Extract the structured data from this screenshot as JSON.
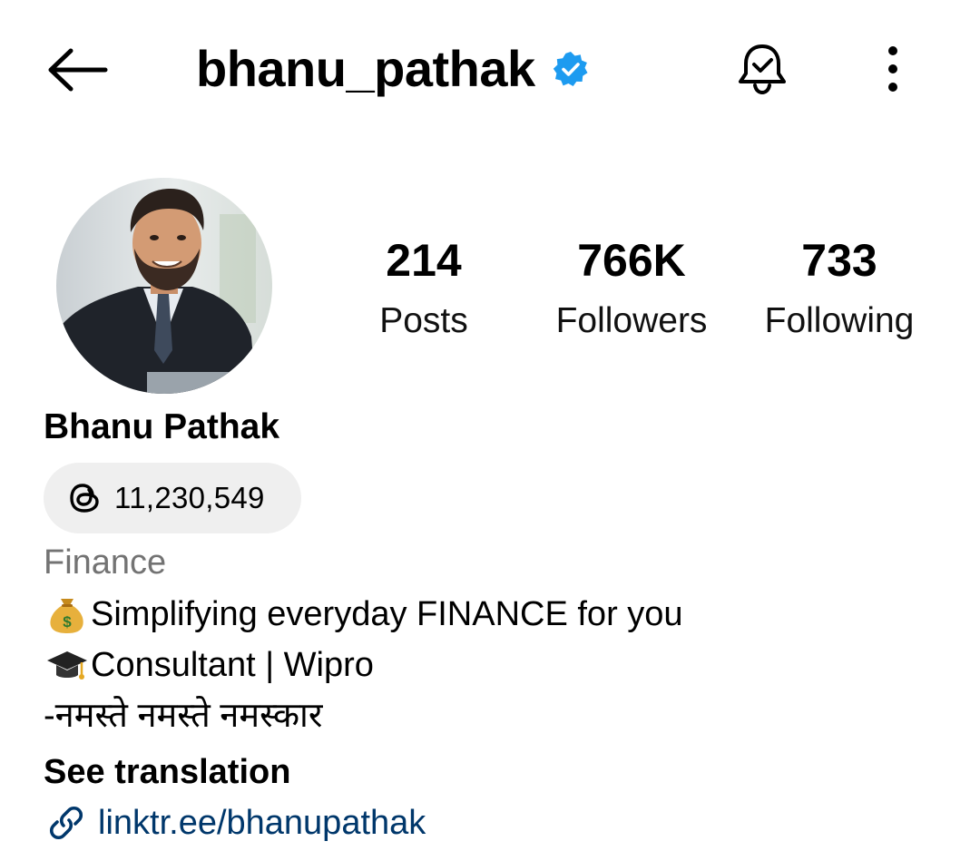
{
  "header": {
    "username": "bhanu_pathak",
    "verified": true,
    "back_icon": "arrow-left-icon",
    "notifications_icon": "bell-check-icon",
    "more_icon": "more-vertical-icon"
  },
  "profile": {
    "avatar_icon": "profile-photo",
    "full_name": "Bhanu Pathak"
  },
  "stats": [
    {
      "value": "214",
      "label": "Posts"
    },
    {
      "value": "766K",
      "label": "Followers"
    },
    {
      "value": "733",
      "label": "Following"
    }
  ],
  "threads": {
    "icon": "threads-icon",
    "count": "11,230,549"
  },
  "bio": {
    "category": "Finance",
    "lines": [
      {
        "emoji": "money-bag-icon",
        "text": "Simplifying everyday FINANCE for you"
      },
      {
        "emoji": "graduation-cap-icon",
        "text": "Consultant | Wipro"
      },
      {
        "text": "-नमस्ते नमस्ते नमस्कार"
      }
    ],
    "translation_label": "See translation",
    "link_icon": "link-icon",
    "link": "linktr.ee/bhanupathak"
  },
  "colors": {
    "verified_blue": "#1d9bf0",
    "link_blue": "#00376b",
    "category_gray": "#737373",
    "pill_gray": "#efefef"
  }
}
